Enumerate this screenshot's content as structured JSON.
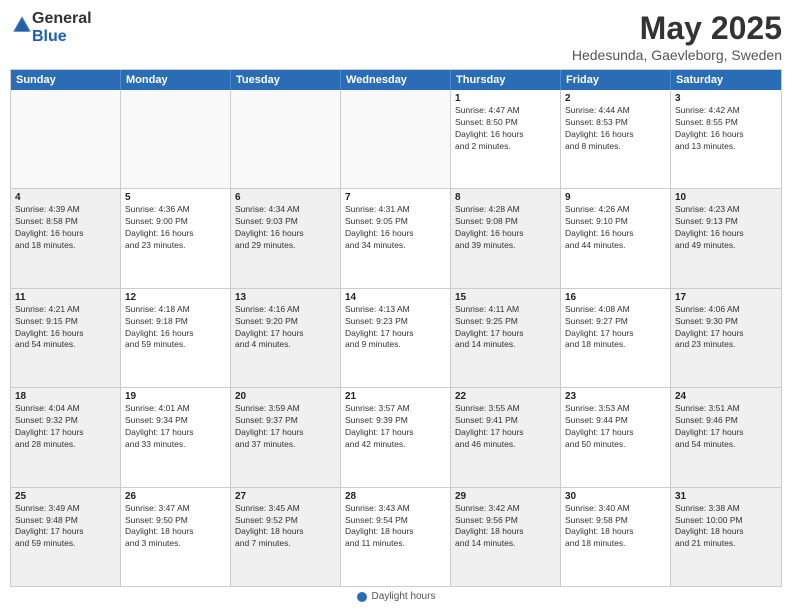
{
  "header": {
    "logo": {
      "general": "General",
      "blue": "Blue"
    },
    "title": "May 2025",
    "subtitle": "Hedesunda, Gaevleborg, Sweden"
  },
  "days_of_week": [
    "Sunday",
    "Monday",
    "Tuesday",
    "Wednesday",
    "Thursday",
    "Friday",
    "Saturday"
  ],
  "footer": {
    "label": "Daylight hours"
  },
  "weeks": [
    [
      {
        "num": "",
        "empty": true
      },
      {
        "num": "",
        "empty": true
      },
      {
        "num": "",
        "empty": true
      },
      {
        "num": "",
        "empty": true
      },
      {
        "num": "1",
        "info": "Sunrise: 4:47 AM\nSunset: 8:50 PM\nDaylight: 16 hours\nand 2 minutes."
      },
      {
        "num": "2",
        "info": "Sunrise: 4:44 AM\nSunset: 8:53 PM\nDaylight: 16 hours\nand 8 minutes."
      },
      {
        "num": "3",
        "info": "Sunrise: 4:42 AM\nSunset: 8:55 PM\nDaylight: 16 hours\nand 13 minutes."
      }
    ],
    [
      {
        "num": "4",
        "shaded": true,
        "info": "Sunrise: 4:39 AM\nSunset: 8:58 PM\nDaylight: 16 hours\nand 18 minutes."
      },
      {
        "num": "5",
        "info": "Sunrise: 4:36 AM\nSunset: 9:00 PM\nDaylight: 16 hours\nand 23 minutes."
      },
      {
        "num": "6",
        "shaded": true,
        "info": "Sunrise: 4:34 AM\nSunset: 9:03 PM\nDaylight: 16 hours\nand 29 minutes."
      },
      {
        "num": "7",
        "info": "Sunrise: 4:31 AM\nSunset: 9:05 PM\nDaylight: 16 hours\nand 34 minutes."
      },
      {
        "num": "8",
        "shaded": true,
        "info": "Sunrise: 4:28 AM\nSunset: 9:08 PM\nDaylight: 16 hours\nand 39 minutes."
      },
      {
        "num": "9",
        "info": "Sunrise: 4:26 AM\nSunset: 9:10 PM\nDaylight: 16 hours\nand 44 minutes."
      },
      {
        "num": "10",
        "shaded": true,
        "info": "Sunrise: 4:23 AM\nSunset: 9:13 PM\nDaylight: 16 hours\nand 49 minutes."
      }
    ],
    [
      {
        "num": "11",
        "shaded": true,
        "info": "Sunrise: 4:21 AM\nSunset: 9:15 PM\nDaylight: 16 hours\nand 54 minutes."
      },
      {
        "num": "12",
        "info": "Sunrise: 4:18 AM\nSunset: 9:18 PM\nDaylight: 16 hours\nand 59 minutes."
      },
      {
        "num": "13",
        "shaded": true,
        "info": "Sunrise: 4:16 AM\nSunset: 9:20 PM\nDaylight: 17 hours\nand 4 minutes."
      },
      {
        "num": "14",
        "info": "Sunrise: 4:13 AM\nSunset: 9:23 PM\nDaylight: 17 hours\nand 9 minutes."
      },
      {
        "num": "15",
        "shaded": true,
        "info": "Sunrise: 4:11 AM\nSunset: 9:25 PM\nDaylight: 17 hours\nand 14 minutes."
      },
      {
        "num": "16",
        "info": "Sunrise: 4:08 AM\nSunset: 9:27 PM\nDaylight: 17 hours\nand 18 minutes."
      },
      {
        "num": "17",
        "shaded": true,
        "info": "Sunrise: 4:06 AM\nSunset: 9:30 PM\nDaylight: 17 hours\nand 23 minutes."
      }
    ],
    [
      {
        "num": "18",
        "shaded": true,
        "info": "Sunrise: 4:04 AM\nSunset: 9:32 PM\nDaylight: 17 hours\nand 28 minutes."
      },
      {
        "num": "19",
        "info": "Sunrise: 4:01 AM\nSunset: 9:34 PM\nDaylight: 17 hours\nand 33 minutes."
      },
      {
        "num": "20",
        "shaded": true,
        "info": "Sunrise: 3:59 AM\nSunset: 9:37 PM\nDaylight: 17 hours\nand 37 minutes."
      },
      {
        "num": "21",
        "info": "Sunrise: 3:57 AM\nSunset: 9:39 PM\nDaylight: 17 hours\nand 42 minutes."
      },
      {
        "num": "22",
        "shaded": true,
        "info": "Sunrise: 3:55 AM\nSunset: 9:41 PM\nDaylight: 17 hours\nand 46 minutes."
      },
      {
        "num": "23",
        "info": "Sunrise: 3:53 AM\nSunset: 9:44 PM\nDaylight: 17 hours\nand 50 minutes."
      },
      {
        "num": "24",
        "shaded": true,
        "info": "Sunrise: 3:51 AM\nSunset: 9:46 PM\nDaylight: 17 hours\nand 54 minutes."
      }
    ],
    [
      {
        "num": "25",
        "shaded": true,
        "info": "Sunrise: 3:49 AM\nSunset: 9:48 PM\nDaylight: 17 hours\nand 59 minutes."
      },
      {
        "num": "26",
        "info": "Sunrise: 3:47 AM\nSunset: 9:50 PM\nDaylight: 18 hours\nand 3 minutes."
      },
      {
        "num": "27",
        "shaded": true,
        "info": "Sunrise: 3:45 AM\nSunset: 9:52 PM\nDaylight: 18 hours\nand 7 minutes."
      },
      {
        "num": "28",
        "info": "Sunrise: 3:43 AM\nSunset: 9:54 PM\nDaylight: 18 hours\nand 11 minutes."
      },
      {
        "num": "29",
        "shaded": true,
        "info": "Sunrise: 3:42 AM\nSunset: 9:56 PM\nDaylight: 18 hours\nand 14 minutes."
      },
      {
        "num": "30",
        "info": "Sunrise: 3:40 AM\nSunset: 9:58 PM\nDaylight: 18 hours\nand 18 minutes."
      },
      {
        "num": "31",
        "shaded": true,
        "info": "Sunrise: 3:38 AM\nSunset: 10:00 PM\nDaylight: 18 hours\nand 21 minutes."
      }
    ]
  ]
}
